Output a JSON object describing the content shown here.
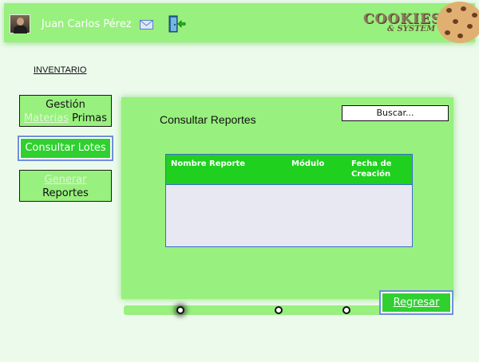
{
  "header": {
    "username": "Juan Carlos Pérez",
    "logo_text": "COOKIES",
    "logo_subtext": "& SYSTEM",
    "bg_color": "#98f07e"
  },
  "nav": {
    "section_link": "INVENTARIO"
  },
  "sidebar": {
    "gestion": {
      "line1": "Gestión",
      "faded_word": "Materias",
      "word2": "Primas"
    },
    "lotes": {
      "label": "Consultar Lotes"
    },
    "reportes": {
      "faded_word": "Generar",
      "word2": "Reportes"
    }
  },
  "main": {
    "title": "Consultar Reportes",
    "search_placeholder": "Buscar...",
    "table": {
      "columns": [
        "Nombre Reporte",
        "Módulo",
        "Fecha de Creación"
      ],
      "rows": []
    }
  },
  "footer": {
    "back_label": "Regresar",
    "steps": 3,
    "active_step": 1
  },
  "colors": {
    "accent": "#2fd02f",
    "panel": "#98f07e",
    "page_bg": "#ecfaec",
    "table_border": "#3a6ad0"
  },
  "icons": [
    "user-avatar",
    "mail-icon",
    "logout-door-icon",
    "cookie-logo"
  ]
}
